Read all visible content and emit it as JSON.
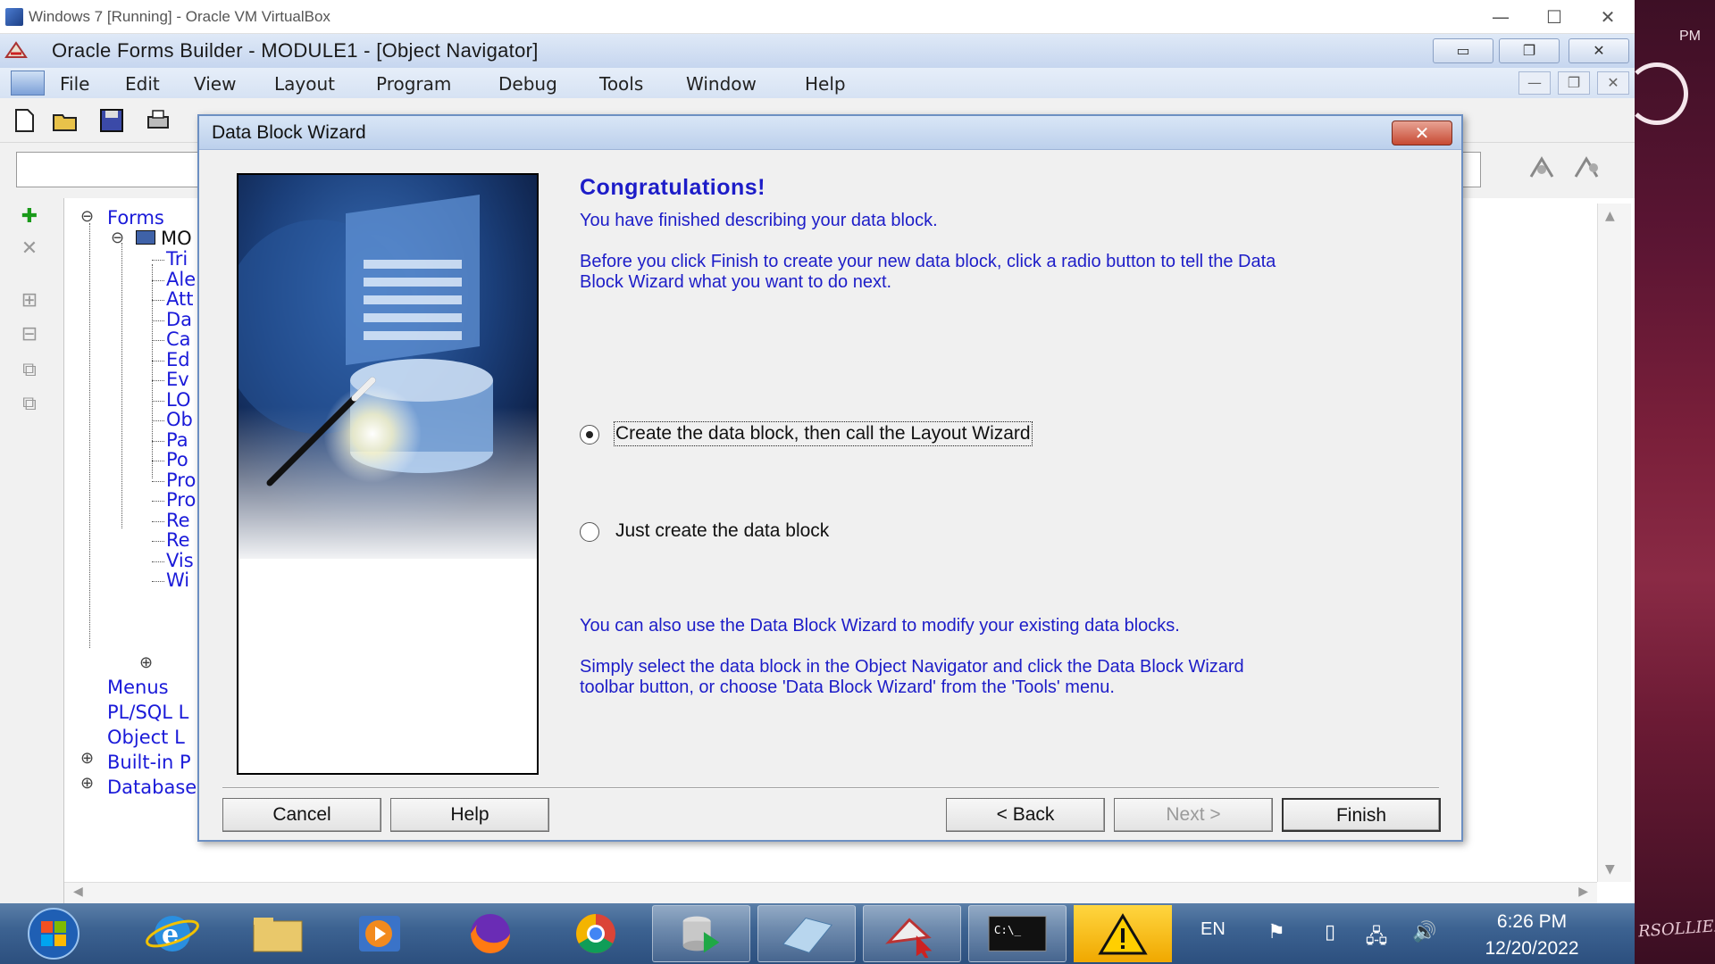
{
  "host": {
    "title": "Windows 7 [Running] - Oracle VM VirtualBox",
    "controls": {
      "minimize": "—",
      "maximize": "☐",
      "close": "✕"
    }
  },
  "desktop": {
    "clock_suffix": "PM",
    "signature": "RSOLLIER"
  },
  "app": {
    "title": "Oracle Forms Builder - MODULE1 - [Object Navigator]",
    "menu": [
      "File",
      "Edit",
      "View",
      "Layout",
      "Program",
      "Debug",
      "Tools",
      "Window",
      "Help"
    ]
  },
  "navigator": {
    "root": "Forms",
    "module": "MO",
    "children": [
      "Tri",
      "Ale",
      "Att",
      "Da",
      "Ca",
      "Ed",
      "Ev",
      "LO",
      "Ob",
      "Pa",
      "Po",
      "Pro",
      "Pro",
      "Re",
      "Re",
      "Vis",
      "Wi"
    ],
    "top_level": [
      "Menus",
      "PL/SQL L",
      "Object L",
      "Built-in P",
      "Database"
    ]
  },
  "wizard": {
    "title": "Data Block Wizard",
    "heading": "Congratulations!",
    "finished_text": "You have finished describing your data block.",
    "instruction_line1": "Before you click Finish to create your new data block, click a radio button to tell the Data",
    "instruction_line2": "Block Wizard what you want to do next.",
    "option_layout": "Create the data block, then call the Layout Wizard",
    "option_just_create": "Just create the data block",
    "modify_text": "You can also use the Data Block Wizard to modify your existing data blocks.",
    "select_line1": "Simply select the data block in the Object Navigator and click the Data Block Wizard",
    "select_line2": "toolbar button, or choose 'Data Block Wizard' from the 'Tools' menu.",
    "selected_option": "option_layout",
    "buttons": {
      "cancel": "Cancel",
      "help": "Help",
      "back": "< Back",
      "next": "Next >",
      "finish": "Finish"
    }
  },
  "taskbar": {
    "apps": [
      "start-orb",
      "internet-explorer",
      "file-explorer",
      "media-player",
      "firefox",
      "chrome",
      "database-installer",
      "notepad",
      "oracle-forms",
      "command-prompt",
      "warning"
    ],
    "language": "EN",
    "time": "6:26 PM",
    "date": "12/20/2022"
  },
  "colors": {
    "link_blue": "#1d1dc8",
    "taskbar": "#3d6392",
    "title_bar": "#c6d6ef"
  }
}
